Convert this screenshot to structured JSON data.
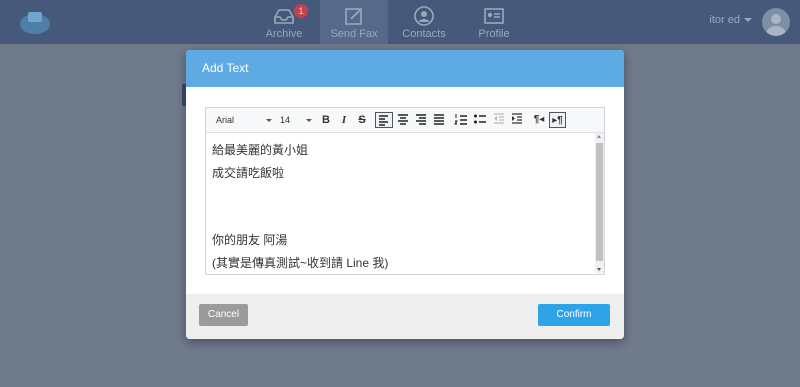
{
  "nav": {
    "items": [
      {
        "label": "Archive",
        "badge": "1"
      },
      {
        "label": "Send Fax"
      },
      {
        "label": "Contacts"
      },
      {
        "label": "Profile"
      }
    ],
    "user_name": "itor ed"
  },
  "modal": {
    "title": "Add Text",
    "toolbar": {
      "font_family": "Arial",
      "font_size": "14",
      "bold": "B",
      "italic": "I",
      "strike": "S"
    },
    "content_lines": [
      "給最美麗的黃小姐",
      "成交請吃飯啦",
      "",
      "",
      "你的朋友 阿湯",
      "(其實是傳真測試~收到請 Line 我)"
    ],
    "cancel_label": "Cancel",
    "confirm_label": "Confirm"
  },
  "colors": {
    "header": "#5eaae3",
    "confirm": "#2fa3e8",
    "cancel": "#9b9b9b",
    "topbar": "#46597a",
    "badge": "#c0444a"
  }
}
